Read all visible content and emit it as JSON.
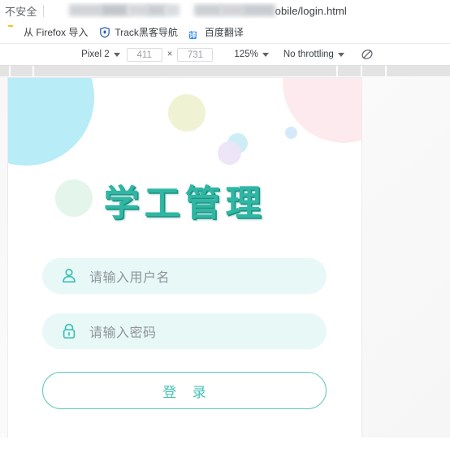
{
  "browser": {
    "security_label": "不安全",
    "url_visible_tail": "obile/login.html",
    "url_redacted": true,
    "bookmarks": [
      {
        "label": "从 Firefox 导入",
        "icon": "folder-icon"
      },
      {
        "label": "Track黑客导航",
        "icon": "shield-icon"
      },
      {
        "label": "百度翻译",
        "icon": "translate-icon",
        "glyph": "译"
      }
    ]
  },
  "device_toolbar": {
    "device": "Pixel 2",
    "width": "411",
    "height": "731",
    "separator": "×",
    "zoom": "125%",
    "throttling": "No throttling",
    "throttle_icon": "no-throttling-icon"
  },
  "page": {
    "app_title": "学工管理",
    "username": {
      "placeholder": "请输入用户名",
      "value": "",
      "icon": "user-icon"
    },
    "password": {
      "placeholder": "请输入密码",
      "value": "",
      "icon": "lock-icon"
    },
    "login_button": "登 录"
  },
  "colors": {
    "title_teal": "#2fb7a4",
    "title_shadow": "#1f8f80",
    "field_bg": "#e7f8f7",
    "button_border": "#5ec9bc",
    "button_text": "#45c2b3",
    "placeholder": "#8f9499",
    "bubble_cyan": "#b8ecf7",
    "bubble_pink": "#fdeaee",
    "bubble_yellow": "#f0f2d4",
    "bubble_purple": "#ece4f8",
    "bubble_blue": "#d4eafa",
    "bubble_mint": "#e4f5ec"
  }
}
